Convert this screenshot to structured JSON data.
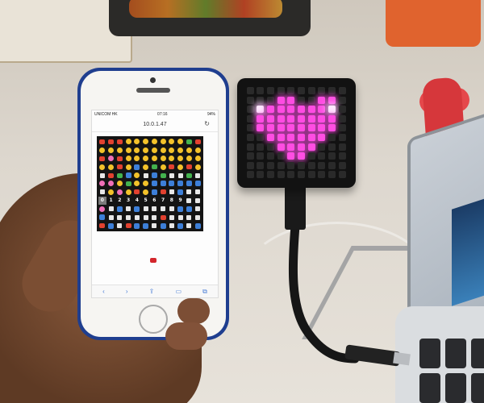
{
  "phone": {
    "status": {
      "carrier": "UNICOM HK",
      "time": "07:16",
      "battery": "94%"
    },
    "address": "10.0.1.47",
    "emoji_grid": {
      "rows": [
        [
          "red",
          "red",
          "red",
          "yellow",
          "yellow",
          "yellow",
          "yellow",
          "yellow",
          "yellow",
          "yellow",
          "green",
          "red"
        ],
        [
          "yellow",
          "yellow",
          "yellow",
          "yellow",
          "yellow",
          "yellow",
          "yellow",
          "yellow",
          "yellow",
          "yellow",
          "yellow",
          "yellow"
        ],
        [
          "red",
          "pink",
          "red",
          "yellow",
          "yellow",
          "yellow",
          "yellow",
          "yellow",
          "yellow",
          "yellow",
          "yellow",
          "yellow"
        ],
        [
          "yellow",
          "yellow",
          "red",
          "yellow",
          "blue",
          "yellow",
          "green",
          "yellow",
          "red",
          "yellow",
          "red",
          "yellow"
        ],
        [
          "white",
          "red",
          "green",
          "blue",
          "yellow",
          "white",
          "blue",
          "green",
          "white",
          "white",
          "green",
          "white"
        ],
        [
          "pink",
          "pink",
          "yellow",
          "green",
          "yellow",
          "yellow",
          "blue",
          "blue",
          "blue",
          "blue",
          "blue",
          "blue"
        ],
        [
          "white",
          "yellow",
          "pink",
          "yellow",
          "red",
          "yellow",
          "blue",
          "red",
          "white",
          "blue",
          "white",
          "white"
        ],
        [
          "num:0",
          "num:1",
          "num:2",
          "num:3",
          "num:4",
          "num:5",
          "num:6",
          "num:7",
          "num:8",
          "num:9",
          "white",
          "white"
        ],
        [
          "pink",
          "white",
          "blue",
          "white",
          "blue",
          "white",
          "white",
          "white",
          "white",
          "blue",
          "blue",
          "white"
        ],
        [
          "blue",
          "white",
          "white",
          "white",
          "white",
          "white",
          "white",
          "red",
          "white",
          "white",
          "white",
          "white"
        ],
        [
          "red",
          "blue",
          "white",
          "red",
          "blue",
          "blue",
          "white",
          "blue",
          "white",
          "blue",
          "white",
          "blue"
        ]
      ]
    }
  },
  "led_matrix": {
    "size": 10,
    "pixels": [
      "..........",
      "...##..##.",
      ".W######W.",
      ".########.",
      ".########.",
      "..######..",
      "...####...",
      "....##....",
      "..........",
      ".........."
    ],
    "colors": {
      "on": "#ff4ee3",
      "highlight": "#ffe9ff",
      "off": "#2a2a2a"
    }
  }
}
